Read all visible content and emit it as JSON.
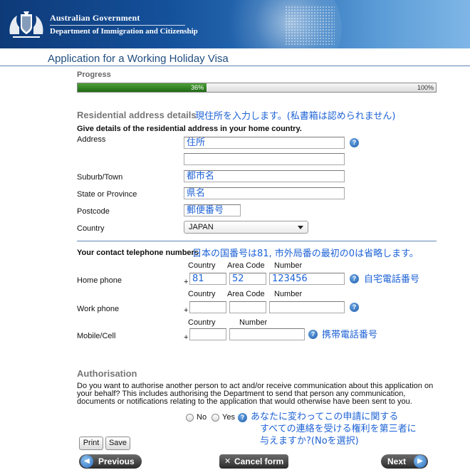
{
  "header": {
    "government": "Australian Government",
    "department": "Department of Immigration and Citizenship"
  },
  "page_title": "Application for a Working Holiday Visa",
  "progress": {
    "label": "Progress",
    "percent_text": "36%",
    "percent_value": 36,
    "max_text": "100%"
  },
  "residential": {
    "title": "Residential address details",
    "note": "現住所を入力します。(私書箱は認められません)",
    "instruction": "Give details of the residential address in your home country.",
    "address_label": "Address",
    "address_line1": "住所",
    "address_line2": "",
    "suburb_label": "Suburb/Town",
    "suburb_value": "都市名",
    "state_label": "State or Province",
    "state_value": "県名",
    "postcode_label": "Postcode",
    "postcode_value": "郵便番号",
    "country_label": "Country",
    "country_value": "JAPAN"
  },
  "contact": {
    "title": "Your contact telephone numbers",
    "note": "日本の国番号は81, 市外局番の最初の0は省略します。",
    "col_country": "Country",
    "col_area": "Area Code",
    "col_number": "Number",
    "plus": "+",
    "home_label": "Home phone",
    "home_country": "81",
    "home_area": "52",
    "home_number": "123456",
    "home_note": "自宅電話番号",
    "work_label": "Work phone",
    "work_country": "",
    "work_area": "",
    "work_number": "",
    "mobile_label": "Mobile/Cell",
    "mobile_country": "",
    "mobile_number": "",
    "mobile_note": "携帯電話番号"
  },
  "authorisation": {
    "title": "Authorisation",
    "text": "Do you want to authorise another person to act and/or receive communication about this application on your behalf? This includes authorising the Department to send that person any communication, documents or notifications relating to the application that would otherwise have been sent to you.",
    "no_label": "No",
    "yes_label": "Yes",
    "note_line1": "あなたに変わってこの申請に関する",
    "note_line2": "すべての連絡を受ける権利を第三者に",
    "note_line3": "与えますか?(Noを選択)"
  },
  "buttons": {
    "print": "Print",
    "save": "Save",
    "previous": "Previous",
    "cancel": "Cancel form",
    "next": "Next"
  },
  "icons": {
    "help": "help-icon",
    "previous": "arrow-left-icon",
    "next": "arrow-right-icon",
    "cancel": "close-icon"
  },
  "colors": {
    "header_blue": "#14509a",
    "title_blue": "#1f4d7e",
    "annotation_blue": "#1d62d6",
    "progress_green": "#2f7f22"
  }
}
